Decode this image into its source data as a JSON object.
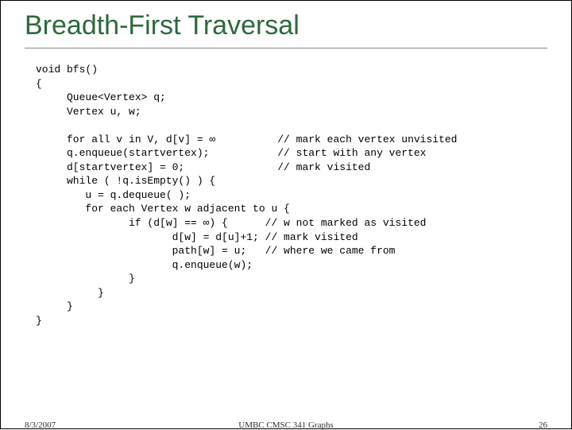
{
  "title": "Breadth-First Traversal",
  "code": {
    "l01": "void bfs()",
    "l02": "{",
    "l03": "     Queue<Vertex> q;",
    "l04": "     Vertex u, w;",
    "l05": "",
    "l06": "     for all v in V, d[v] = ∞          // mark each vertex unvisited",
    "l07": "     q.enqueue(startvertex);           // start with any vertex",
    "l08": "     d[startvertex] = 0;               // mark visited",
    "l09": "     while ( !q.isEmpty() ) {",
    "l10": "        u = q.dequeue( );",
    "l11": "        for each Vertex w adjacent to u {",
    "l12": "               if (d[w] == ∞) {      // w not marked as visited",
    "l13": "                      d[w] = d[u]+1; // mark visited",
    "l14": "                      path[w] = u;   // where we came from",
    "l15": "                      q.enqueue(w);",
    "l16": "               }",
    "l17": "          }",
    "l18": "     }",
    "l19": "}"
  },
  "footer": {
    "date": "8/3/2007",
    "middle": "UMBC CMSC 341 Graphs",
    "page": "26"
  }
}
